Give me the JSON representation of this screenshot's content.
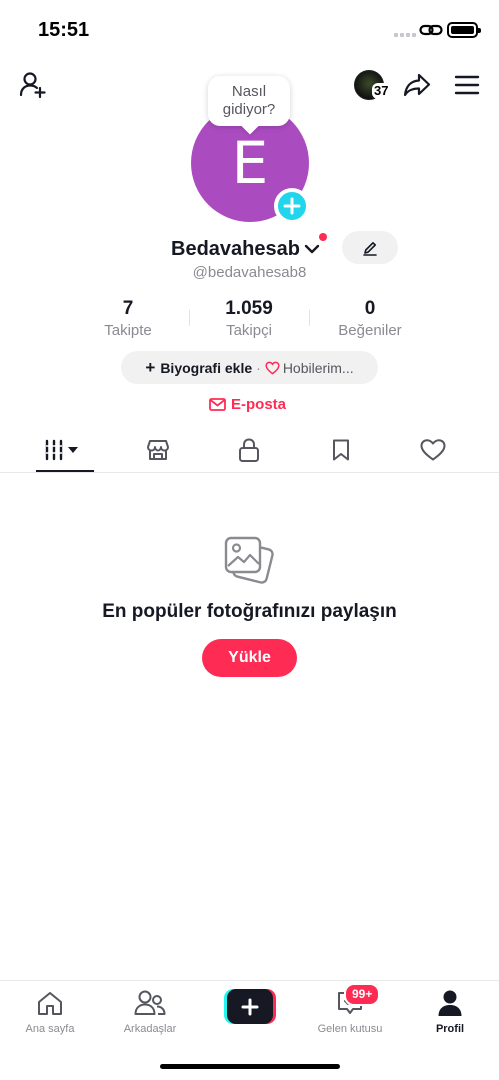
{
  "status_bar": {
    "time": "15:51"
  },
  "header": {
    "following_avatar_count": "37"
  },
  "profile": {
    "avatar_letter": "E",
    "bubble_text": "Nasıl gidiyor?",
    "display_name": "Bedavahesab",
    "username": "@bedavahesab8",
    "stats": [
      {
        "value": "7",
        "label": "Takipte"
      },
      {
        "value": "1.059",
        "label": "Takipçi"
      },
      {
        "value": "0",
        "label": "Beğeniler"
      }
    ],
    "bio_add_label": "Biyografi ekle",
    "bio_separator": "·",
    "hobbies_label": "Hobilerim...",
    "email_label": "E-posta"
  },
  "tabs": [
    {
      "icon": "grid-videos-icon",
      "active": true
    },
    {
      "icon": "shop-icon",
      "active": false
    },
    {
      "icon": "lock-icon",
      "active": false
    },
    {
      "icon": "bookmark-icon",
      "active": false
    },
    {
      "icon": "heart-icon",
      "active": false
    }
  ],
  "empty_state": {
    "title": "En popüler fotoğrafınızı paylaşın",
    "button_label": "Yükle"
  },
  "bottom_nav": {
    "items": [
      {
        "label": "Ana sayfa",
        "icon": "home-icon"
      },
      {
        "label": "Arkadaşlar",
        "icon": "friends-icon"
      },
      {
        "label": "",
        "icon": "create-plus-icon"
      },
      {
        "label": "Gelen kutusu",
        "icon": "inbox-icon"
      },
      {
        "label": "Profil",
        "icon": "profile-icon",
        "active": true
      }
    ],
    "inbox_badge": "99+"
  },
  "colors": {
    "accent": "#fe2c55",
    "avatar_bg": "#ab4bc0",
    "cyan": "#20d5ec"
  }
}
